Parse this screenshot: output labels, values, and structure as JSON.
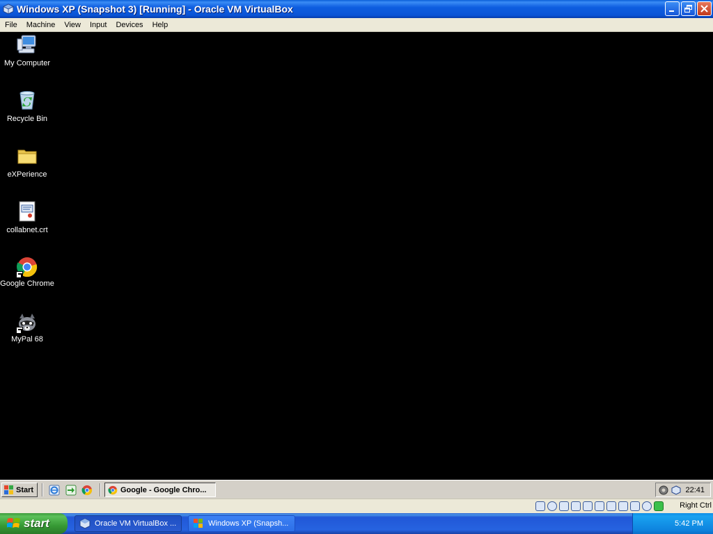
{
  "window": {
    "title": "Windows XP (Snapshot 3) [Running] - Oracle VM VirtualBox",
    "icon": "virtualbox-icon",
    "buttons": [
      "minimize-icon",
      "restore-icon",
      "close-icon"
    ]
  },
  "menubar": {
    "items": [
      "File",
      "Machine",
      "View",
      "Input",
      "Devices",
      "Help"
    ]
  },
  "desktop": {
    "icons": [
      {
        "label": "My Computer",
        "icon": "my-computer-icon"
      },
      {
        "label": "Recycle Bin",
        "icon": "recycle-bin-icon"
      },
      {
        "label": "eXPerience",
        "icon": "folder-icon"
      },
      {
        "label": "collabnet.crt",
        "icon": "certificate-file-icon"
      },
      {
        "label": "Google Chrome",
        "icon": "chrome-icon",
        "shortcut": true
      },
      {
        "label": "MyPal 68",
        "icon": "mypal-icon",
        "shortcut": true
      }
    ]
  },
  "guest_taskbar": {
    "start_label": "Start",
    "quicklaunch": [
      "ie-icon",
      "arrow-icon",
      "chrome-icon"
    ],
    "task": {
      "label": "Google - Google Chro...",
      "icon": "chrome-icon"
    },
    "clock": "22:41"
  },
  "vbox_status": {
    "right_ctrl": "Right Ctrl"
  },
  "host_taskbar": {
    "start_label": "start",
    "tasks": [
      {
        "label": "Oracle VM VirtualBox ...",
        "active": true,
        "icon": "virtualbox-icon"
      },
      {
        "label": "Windows XP (Snapsh...",
        "active": false,
        "icon": "virtualbox-vm-icon"
      }
    ],
    "clock": "5:42 PM"
  }
}
